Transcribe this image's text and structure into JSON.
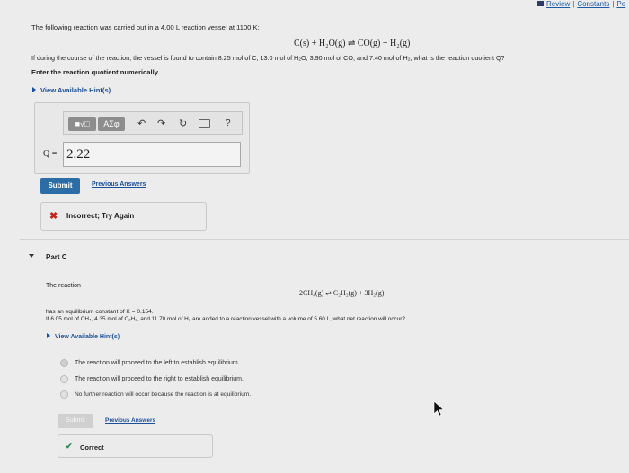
{
  "top_links": {
    "review": "Review",
    "constants": "Constants",
    "periodic": "Pe"
  },
  "part_b": {
    "prompt_line1": "The following reaction was carried out in a 4.00 L reaction vessel at 1100 K:",
    "reaction": "C(s) + H₂O(g) ⇌ CO(g) + H₂(g)",
    "prompt_line2": "If during the course of the reaction, the vessel is found to contain 8.25 mol of C, 13.0 mol of H₂O, 3.90 mol of CO, and 7.40 mol of H₂, what is the reaction quotient Q?",
    "instruction": "Enter the reaction quotient numerically.",
    "hint_link": "View Available Hint(s)",
    "toolbar": {
      "templates_btn": "■√□",
      "symbols_btn": "AΣφ",
      "help": "?"
    },
    "answer_label": "Q =",
    "answer_value": "2.22",
    "submit": "Submit",
    "previous_answers": "Previous Answers",
    "feedback": "Incorrect; Try Again"
  },
  "part_c": {
    "label": "Part C",
    "intro": "The reaction",
    "reaction": "2CH₄(g) ⇌ C₂H₂(g) + 3H₂(g)",
    "line1": "has an equilibrium constant of K = 0.154.",
    "line2": "If 6.05 mol of CH₄, 4.35 mol of C₂H₂, and 11.70 mol of H₂ are added to a reaction vessel with a volume of 5.60 L, what net reaction will occur?",
    "hint_link": "View Available Hint(s)",
    "options": [
      "The reaction will proceed to the left to establish equilibrium.",
      "The reaction will proceed to the right to establish equilibrium.",
      "No further reaction will occur because the reaction is at equilibrium."
    ],
    "selected_option_index": 0,
    "submit": "Submit",
    "previous_answers": "Previous Answers",
    "feedback": "Correct"
  },
  "colors": {
    "link": "#1a4f9a",
    "submit": "#2d6da7",
    "incorrect": "#c2261e",
    "correct": "#2e8b57"
  }
}
